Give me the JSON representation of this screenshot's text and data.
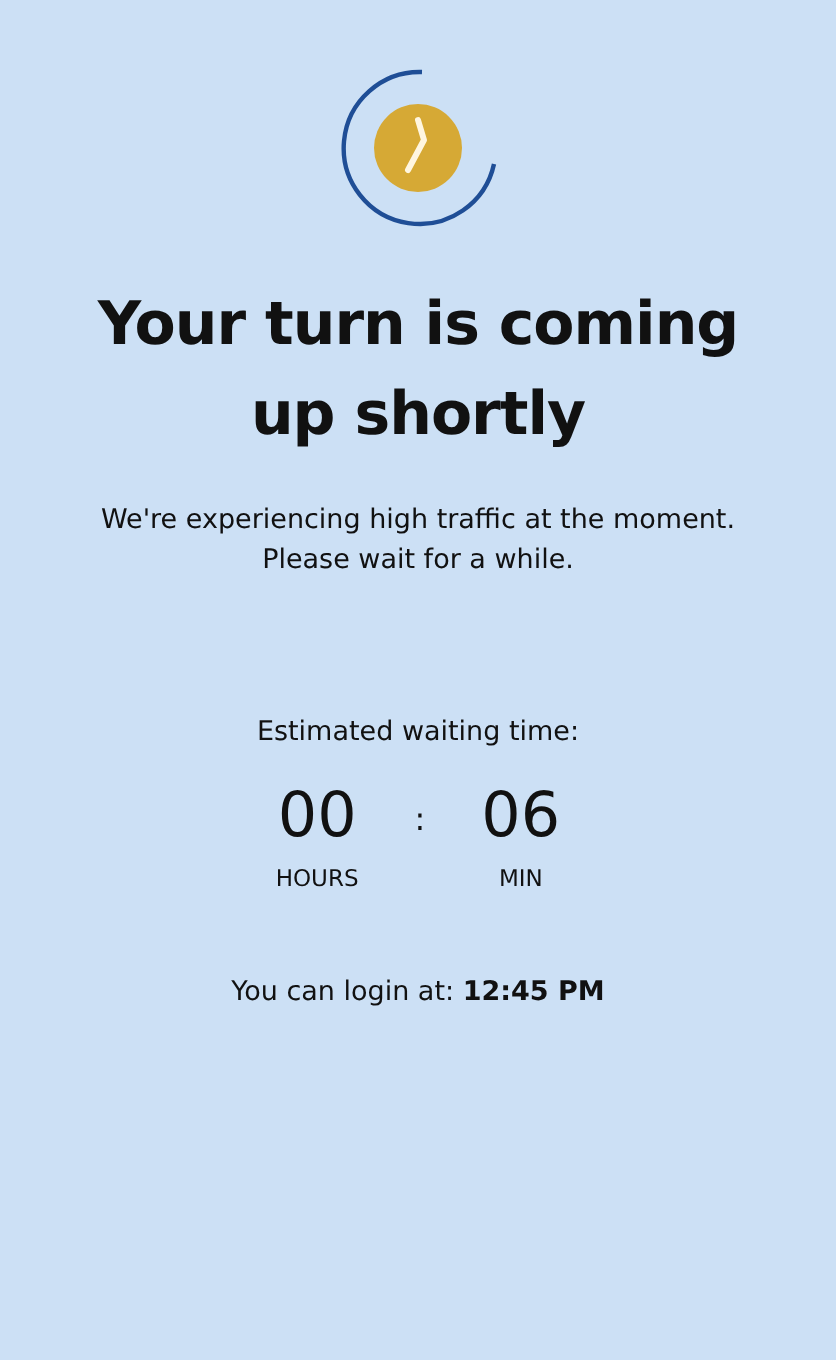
{
  "title": "Your turn is coming up shortly",
  "message": [
    "We're experiencing high traffic at the moment.",
    "Please wait for a while."
  ],
  "estimate_label": "Estimated waiting time:",
  "timer": {
    "separator": ":",
    "units": [
      {
        "value": "00",
        "label": "HOURS"
      },
      {
        "value": "06",
        "label": "MIN"
      }
    ]
  },
  "login_note": "You can login at: **12:45 PM**"
}
